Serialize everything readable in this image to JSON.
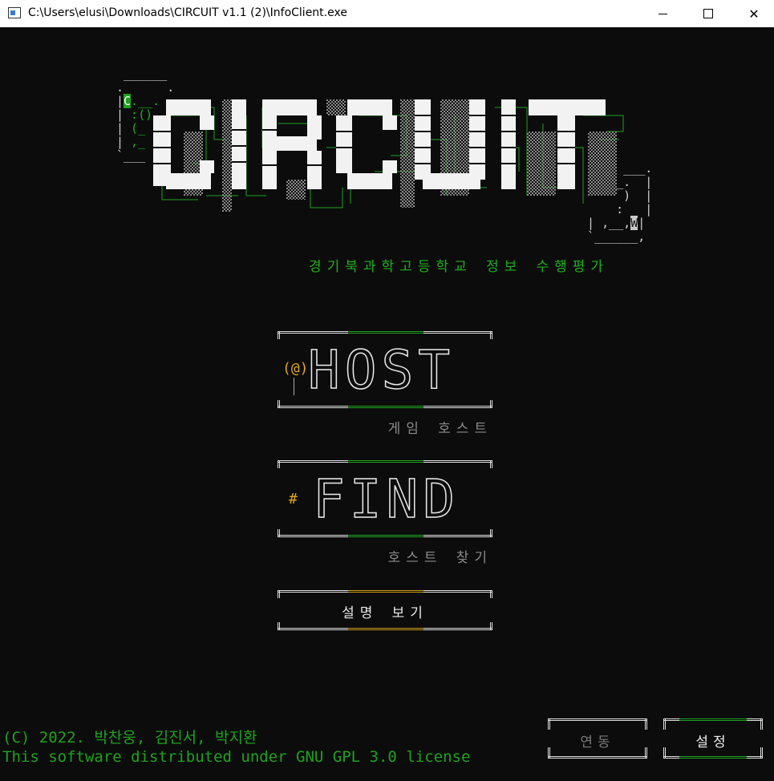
{
  "window": {
    "title": "C:\\Users\\elusi\\Downloads\\CIRCUIT v1.1 (2)\\InfoClient.exe",
    "controls": [
      "—",
      "☐",
      "✕"
    ]
  },
  "logo": {
    "title": "CIRCUIT",
    "subtitle": "경기북과학고등학교 정보 수행평가",
    "mark_left": "C",
    "mark_right": "W"
  },
  "menu": {
    "host": {
      "icon": "(@)",
      "label": "HOST",
      "sublabel": "게임 호스트"
    },
    "find": {
      "icon": "#",
      "label": "FIND",
      "sublabel": "호스트 찾기"
    },
    "help": {
      "label": "설명 보기"
    }
  },
  "footer": {
    "copyright": "(C) 2022. 박찬웅, 김진서, 박지환",
    "license": "This software distributed under GNU GPL 3.0 license",
    "link_button": "연동",
    "settings_button": "설정"
  },
  "colors": {
    "background": "#0c0c0c",
    "accent_green": "#1fa11f",
    "accent_amber": "#c89a1a",
    "text": "#e8e8e8",
    "muted": "#8a8a8a"
  }
}
